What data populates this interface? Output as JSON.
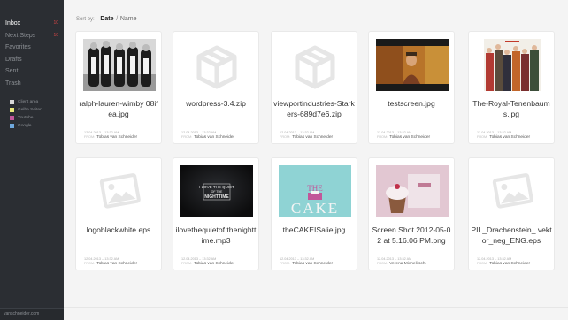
{
  "sidebar": {
    "nav": [
      {
        "label": "Inbox",
        "badge": "10",
        "active": true
      },
      {
        "label": "Next Steps",
        "badge": "10",
        "active": false
      },
      {
        "label": "Favorites",
        "badge": "",
        "active": false
      },
      {
        "label": "Drafts",
        "badge": "",
        "active": false
      },
      {
        "label": "Sent",
        "badge": "",
        "active": false
      },
      {
        "label": "Trash",
        "badge": "",
        "active": false
      }
    ],
    "labels": [
      {
        "name": "Client area",
        "color": "#d9d9d9"
      },
      {
        "name": "Gelbe Seiten",
        "color": "#e8e87a"
      },
      {
        "name": "Youtube",
        "color": "#c2579c"
      },
      {
        "name": "Google",
        "color": "#6fa8dc"
      }
    ],
    "footer": "vanschneider.com"
  },
  "sort": {
    "label": "Sort by:",
    "active": "Date",
    "separator": "/",
    "other": "Name"
  },
  "files": [
    {
      "name": "ralph-lauren-wimby 08ifea.jpg",
      "date": "12.04.2013 – 13:32 AM",
      "from_label": "FROM:",
      "from": "Tobias van Schneider",
      "thumb": "photo-bw"
    },
    {
      "name": "wordpress-3.4.zip",
      "date": "12.04.2013 – 13:32 AM",
      "from_label": "FROM:",
      "from": "Tobias van Schneider",
      "thumb": "archive-icon"
    },
    {
      "name": "viewportindustries-Starkers-689d7e6.zip",
      "date": "12.04.2013 – 13:32 AM",
      "from_label": "FROM:",
      "from": "Tobias van Schneider",
      "thumb": "archive-icon"
    },
    {
      "name": "testscreen.jpg",
      "date": "12.04.2013 – 13:32 AM",
      "from_label": "FROM:",
      "from": "Tobias van Schneider",
      "thumb": "photo-film"
    },
    {
      "name": "The-Royal-Tenenbaums.jpg",
      "date": "12.04.2013 – 13:32 AM",
      "from_label": "FROM:",
      "from": "Tobias van Schneider",
      "thumb": "photo-poster"
    },
    {
      "name": "logoblackwhite.eps",
      "date": "12.04.2013 – 13:32 AM",
      "from_label": "FROM:",
      "from": "Tobias van Schneider",
      "thumb": "image-icon"
    },
    {
      "name": "ilovethequietof thenighttime.mp3",
      "date": "12.04.2013 – 13:32 AM",
      "from_label": "FROM:",
      "from": "Tobias van Schneider",
      "thumb": "album-dark",
      "album_text": [
        "I LOVE THE QUIET",
        "OF THE",
        "NIGHTTIME"
      ]
    },
    {
      "name": "theCAKEISalie.jpg",
      "date": "12.04.2013 – 13:32 AM",
      "from_label": "FROM:",
      "from": "Tobias van Schneider",
      "thumb": "cake-poster",
      "poster_text": [
        "THE",
        "CAKE"
      ]
    },
    {
      "name": "Screen Shot 2012-05-02 at 5.16.06 PM.png",
      "date": "12.04.2013 – 13:32 AM",
      "from_label": "FROM:",
      "from": "Verena Michelitsch",
      "thumb": "photo-cupcake"
    },
    {
      "name": "PIL_Drachenstein_ vektor_neg_ENG.eps",
      "date": "12.04.2013 – 13:32 AM",
      "from_label": "FROM:",
      "from": "Tobias van Schneider",
      "thumb": "image-icon"
    }
  ]
}
